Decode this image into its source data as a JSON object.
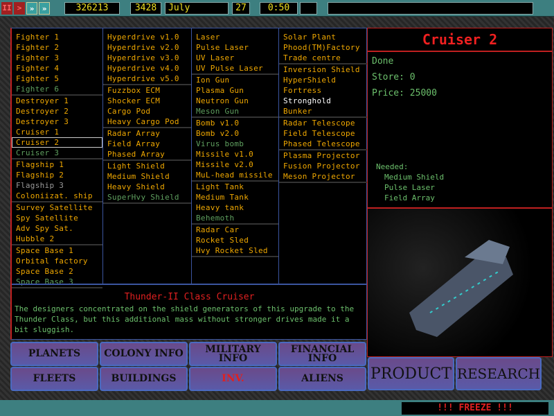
{
  "topbar": {
    "money": "326213",
    "year": "3428",
    "month": "July",
    "day": "27",
    "time": "0:50",
    "controls": [
      "pause",
      "play",
      "fast",
      "faster"
    ]
  },
  "columns": [
    [
      [
        {
          "label": "Fighter 1",
          "state": "normal"
        },
        {
          "label": "Fighter 2",
          "state": "normal"
        },
        {
          "label": "Fighter 3",
          "state": "normal"
        },
        {
          "label": "Fighter 4",
          "state": "normal"
        },
        {
          "label": "Fighter 5",
          "state": "normal"
        },
        {
          "label": "Fighter 6",
          "state": "green"
        }
      ],
      [
        {
          "label": "Destroyer 1",
          "state": "normal"
        },
        {
          "label": "Destroyer 2",
          "state": "normal"
        },
        {
          "label": "Destroyer 3",
          "state": "normal"
        },
        {
          "label": "Cruiser 1",
          "state": "normal"
        },
        {
          "label": "Cruiser 2",
          "state": "normal",
          "selected": true
        },
        {
          "label": "Cruiser 3",
          "state": "green"
        }
      ],
      [
        {
          "label": "Flagship 1",
          "state": "normal"
        },
        {
          "label": "Flagship 2",
          "state": "normal"
        },
        {
          "label": "Flagship 3",
          "state": "grey"
        },
        {
          "label": "Coloniizat. ship",
          "state": "normal"
        }
      ],
      [
        {
          "label": "Survey Satellite",
          "state": "normal"
        },
        {
          "label": "Spy Satellite",
          "state": "normal"
        },
        {
          "label": "Adv Spy Sat.",
          "state": "normal"
        },
        {
          "label": "Hubble 2",
          "state": "normal"
        }
      ],
      [
        {
          "label": "Space Base 1",
          "state": "normal"
        },
        {
          "label": "Orbital factory",
          "state": "normal"
        },
        {
          "label": "Space Base 2",
          "state": "normal"
        },
        {
          "label": "Space Base 3",
          "state": "green"
        }
      ]
    ],
    [
      [
        {
          "label": "Hyperdrive v1.0",
          "state": "normal"
        },
        {
          "label": "Hyperdrive v2.0",
          "state": "normal"
        },
        {
          "label": "Hyperdrive v3.0",
          "state": "normal"
        },
        {
          "label": "Hyperdrive v4.0",
          "state": "normal"
        },
        {
          "label": "Hyperdrive v5.0",
          "state": "normal"
        }
      ],
      [
        {
          "label": "Fuzzbox ECM",
          "state": "normal"
        },
        {
          "label": "Shocker ECM",
          "state": "normal"
        },
        {
          "label": "Cargo Pod",
          "state": "normal"
        },
        {
          "label": "Heavy Cargo Pod",
          "state": "normal"
        }
      ],
      [
        {
          "label": "Radar Array",
          "state": "normal"
        },
        {
          "label": "Field Array",
          "state": "normal"
        },
        {
          "label": "Phased Array",
          "state": "normal"
        }
      ],
      [
        {
          "label": "Light Shield",
          "state": "normal"
        },
        {
          "label": "Medium Shield",
          "state": "normal"
        },
        {
          "label": "Heavy Shield",
          "state": "normal"
        },
        {
          "label": "SuperHvy Shield",
          "state": "green"
        }
      ]
    ],
    [
      [
        {
          "label": "Laser",
          "state": "normal"
        },
        {
          "label": "Pulse Laser",
          "state": "normal"
        },
        {
          "label": "UV Laser",
          "state": "normal"
        },
        {
          "label": "UV Pulse Laser",
          "state": "normal"
        }
      ],
      [
        {
          "label": "Ion Gun",
          "state": "normal"
        },
        {
          "label": "Plasma Gun",
          "state": "normal"
        },
        {
          "label": "Neutron Gun",
          "state": "normal"
        },
        {
          "label": "Meson Gun",
          "state": "green"
        }
      ],
      [
        {
          "label": "Bomb v1.0",
          "state": "normal"
        },
        {
          "label": "Bomb v2.0",
          "state": "normal"
        },
        {
          "label": "Virus bomb",
          "state": "green"
        },
        {
          "label": "Missile v1.0",
          "state": "normal"
        },
        {
          "label": "Missile v2.0",
          "state": "normal"
        },
        {
          "label": "MuL-head missile",
          "state": "normal"
        }
      ],
      [
        {
          "label": "Light Tank",
          "state": "normal"
        },
        {
          "label": "Medium Tank",
          "state": "normal"
        },
        {
          "label": "Heavy tank",
          "state": "normal"
        },
        {
          "label": "Behemoth",
          "state": "green"
        }
      ],
      [
        {
          "label": "Radar Car",
          "state": "normal"
        },
        {
          "label": "Rocket Sled",
          "state": "normal"
        },
        {
          "label": "Hvy Rocket Sled",
          "state": "normal"
        }
      ]
    ],
    [
      [
        {
          "label": "Solar Plant",
          "state": "normal"
        },
        {
          "label": "Phood(TM)Factory",
          "state": "normal"
        },
        {
          "label": "Trade centre",
          "state": "normal"
        }
      ],
      [
        {
          "label": "Inversion Shield",
          "state": "normal"
        },
        {
          "label": "HyperShield",
          "state": "normal"
        },
        {
          "label": "Fortress",
          "state": "normal"
        },
        {
          "label": "Stronghold",
          "state": "white"
        },
        {
          "label": "Bunker",
          "state": "normal"
        }
      ],
      [
        {
          "label": "Radar Telescope",
          "state": "normal"
        },
        {
          "label": "Field Telescope",
          "state": "normal"
        },
        {
          "label": "Phased Telescope",
          "state": "normal"
        }
      ],
      [
        {
          "label": "Plasma Projector",
          "state": "normal"
        },
        {
          "label": "Fusion Projector",
          "state": "normal"
        },
        {
          "label": "Meson Projector",
          "state": "normal"
        }
      ]
    ]
  ],
  "description": {
    "title": "Thunder-II Class Cruiser",
    "text": "The designers concentrated on the shield generators of this upgrade to the Thunder Class, but this additional mass without stronger drives made it a bit sluggish."
  },
  "nav": {
    "planets": "PLANETS",
    "colony": "COLONY INFO",
    "military": "MILITARY INFO",
    "financial": "FINANCIAL INFO",
    "fleets": "FLEETS",
    "buildings": "BUILDINGS",
    "inv": "INV.",
    "aliens": "ALIENS"
  },
  "detail": {
    "title": "Cruiser 2",
    "status": "Done",
    "store": "Store: 0",
    "price": "Price: 25000",
    "needed_label": "Needed:",
    "needed": [
      "Medium Shield",
      "Pulse Laser",
      "Field Array"
    ]
  },
  "actions": {
    "product": "PRODUCT",
    "research": "RESEARCH"
  },
  "status_bar": {
    "message": "!!! FREEZE !!!"
  }
}
